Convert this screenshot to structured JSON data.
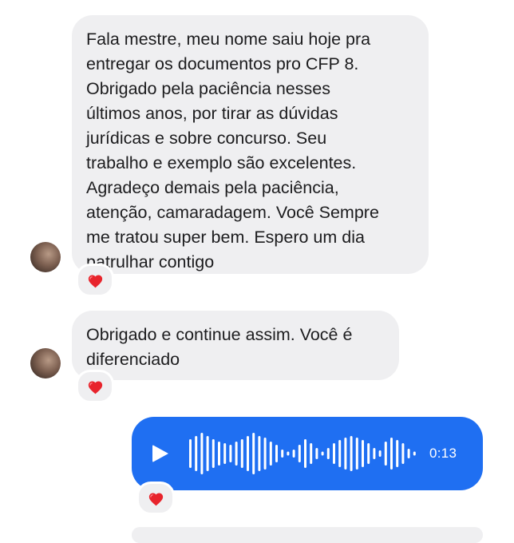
{
  "conversation": {
    "messages": [
      {
        "direction": "incoming",
        "type": "text",
        "lines": [
          "Fala mestre, meu nome saiu hoje pra",
          "entregar os documentos pro CFP 8.",
          "Obrigado pela paciência nesses",
          "últimos anos, por tirar as dúvidas",
          "jurídicas e sobre concurso. Seu",
          "trabalho e exemplo são excelentes.",
          "Agradeço demais pela paciência,",
          "atenção, camaradagem. Você Sempre",
          "me tratou super bem. Espero um dia",
          "patrulhar contigo"
        ],
        "reaction": "❤️"
      },
      {
        "direction": "incoming",
        "type": "text",
        "lines": [
          "Obrigado e continue assim. Você é",
          "diferenciado"
        ],
        "reaction": "❤️"
      },
      {
        "direction": "outgoing",
        "type": "voice",
        "duration": "0:13",
        "reaction": "❤️"
      }
    ]
  },
  "colors": {
    "incoming_bubble": "#efeff1",
    "outgoing_bubble": "#1f6ff2",
    "text": "#1c1c1e",
    "reaction_heart": "#e8242c"
  },
  "icons": {
    "play": "play-icon",
    "reaction": "heart-icon",
    "waveform": "waveform-icon"
  }
}
